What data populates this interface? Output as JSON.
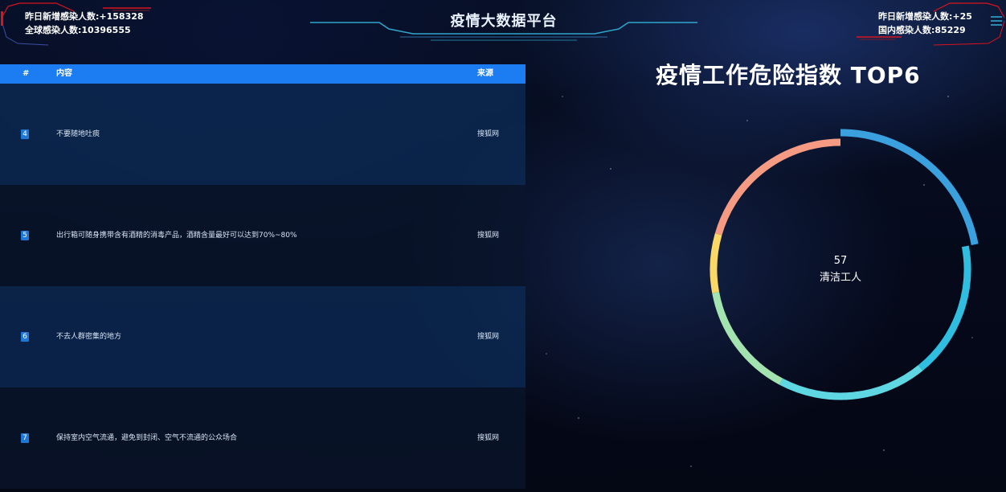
{
  "header": {
    "title": "疫情大数据平台",
    "left_stats": [
      "昨日新增感染人数:+158328",
      "全球感染人数:10396555"
    ],
    "right_stats": [
      "昨日新增感染人数:+25",
      "国内感染人数:85229"
    ],
    "menu_icon": "menu-icon"
  },
  "table": {
    "headers": {
      "index": "#",
      "content": "内容",
      "source": "来源"
    },
    "rows": [
      {
        "index": "4",
        "content": "不要随地吐痰",
        "source": "搜狐网"
      },
      {
        "index": "5",
        "content": "出行箱可随身携带含有酒精的消毒产品，酒精含量最好可以达到70%~80%",
        "source": "搜狐网"
      },
      {
        "index": "6",
        "content": "不去人群密集的地方",
        "source": "搜狐网"
      },
      {
        "index": "7",
        "content": "保持室内空气流通，避免到封闭、空气不流通的公众场合",
        "source": "搜狐网"
      }
    ]
  },
  "chart_data": {
    "type": "pie",
    "title": "疫情工作危险指数 TOP6",
    "center_value": "57",
    "center_label": "清洁工人",
    "highlighted_index": 0,
    "slices": [
      {
        "value": 57,
        "color": "#3aa0de"
      },
      {
        "value": 44,
        "color": "#2fbde0"
      },
      {
        "value": 48,
        "color": "#5fd7e2"
      },
      {
        "value": 37,
        "color": "#a3e3b0"
      },
      {
        "value": 19,
        "color": "#f9d865"
      },
      {
        "value": 53,
        "color": "#f59a83"
      }
    ]
  },
  "colors": {
    "table_header": "#1c7cf2",
    "index_badge": "#1f78d6",
    "deco_red": "#d9141e",
    "deco_cyan": "#2fa6cc"
  }
}
